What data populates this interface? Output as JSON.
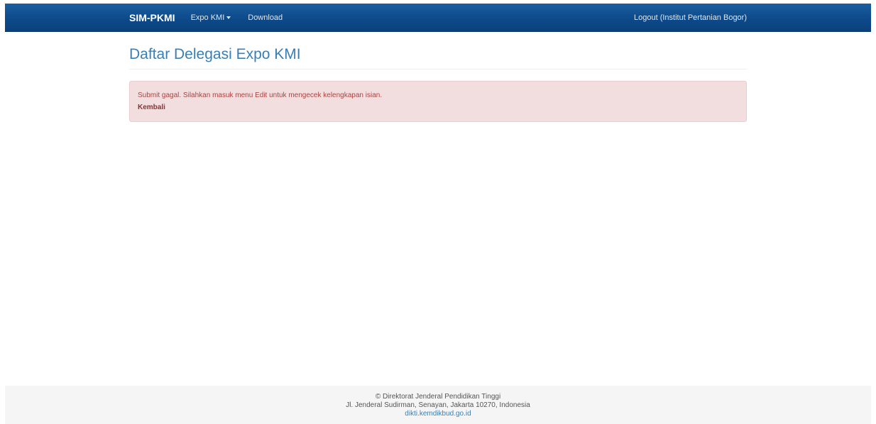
{
  "navbar": {
    "brand": "SIM-PKMI",
    "menu_expo": "Expo KMI",
    "menu_download": "Download",
    "logout": "Logout (Institut Pertanian Bogor)"
  },
  "main": {
    "title": "Daftar Delegasi Expo KMI",
    "alert_message": "Submit gagal. Silahkan masuk menu Edit untuk mengecek kelengkapan isian.",
    "alert_link": "Kembali"
  },
  "footer": {
    "line1": "© Direktorat Jenderal Pendidikan Tinggi",
    "line2": "Jl. Jenderal Sudirman, Senayan, Jakarta 10270, Indonesia",
    "link": "dikti.kemdikbud.go.id"
  },
  "colors": {
    "navbar": "#0d4a8a",
    "title": "#3a7fb3",
    "alert_bg": "#f2dede",
    "alert_text": "#a94442"
  }
}
